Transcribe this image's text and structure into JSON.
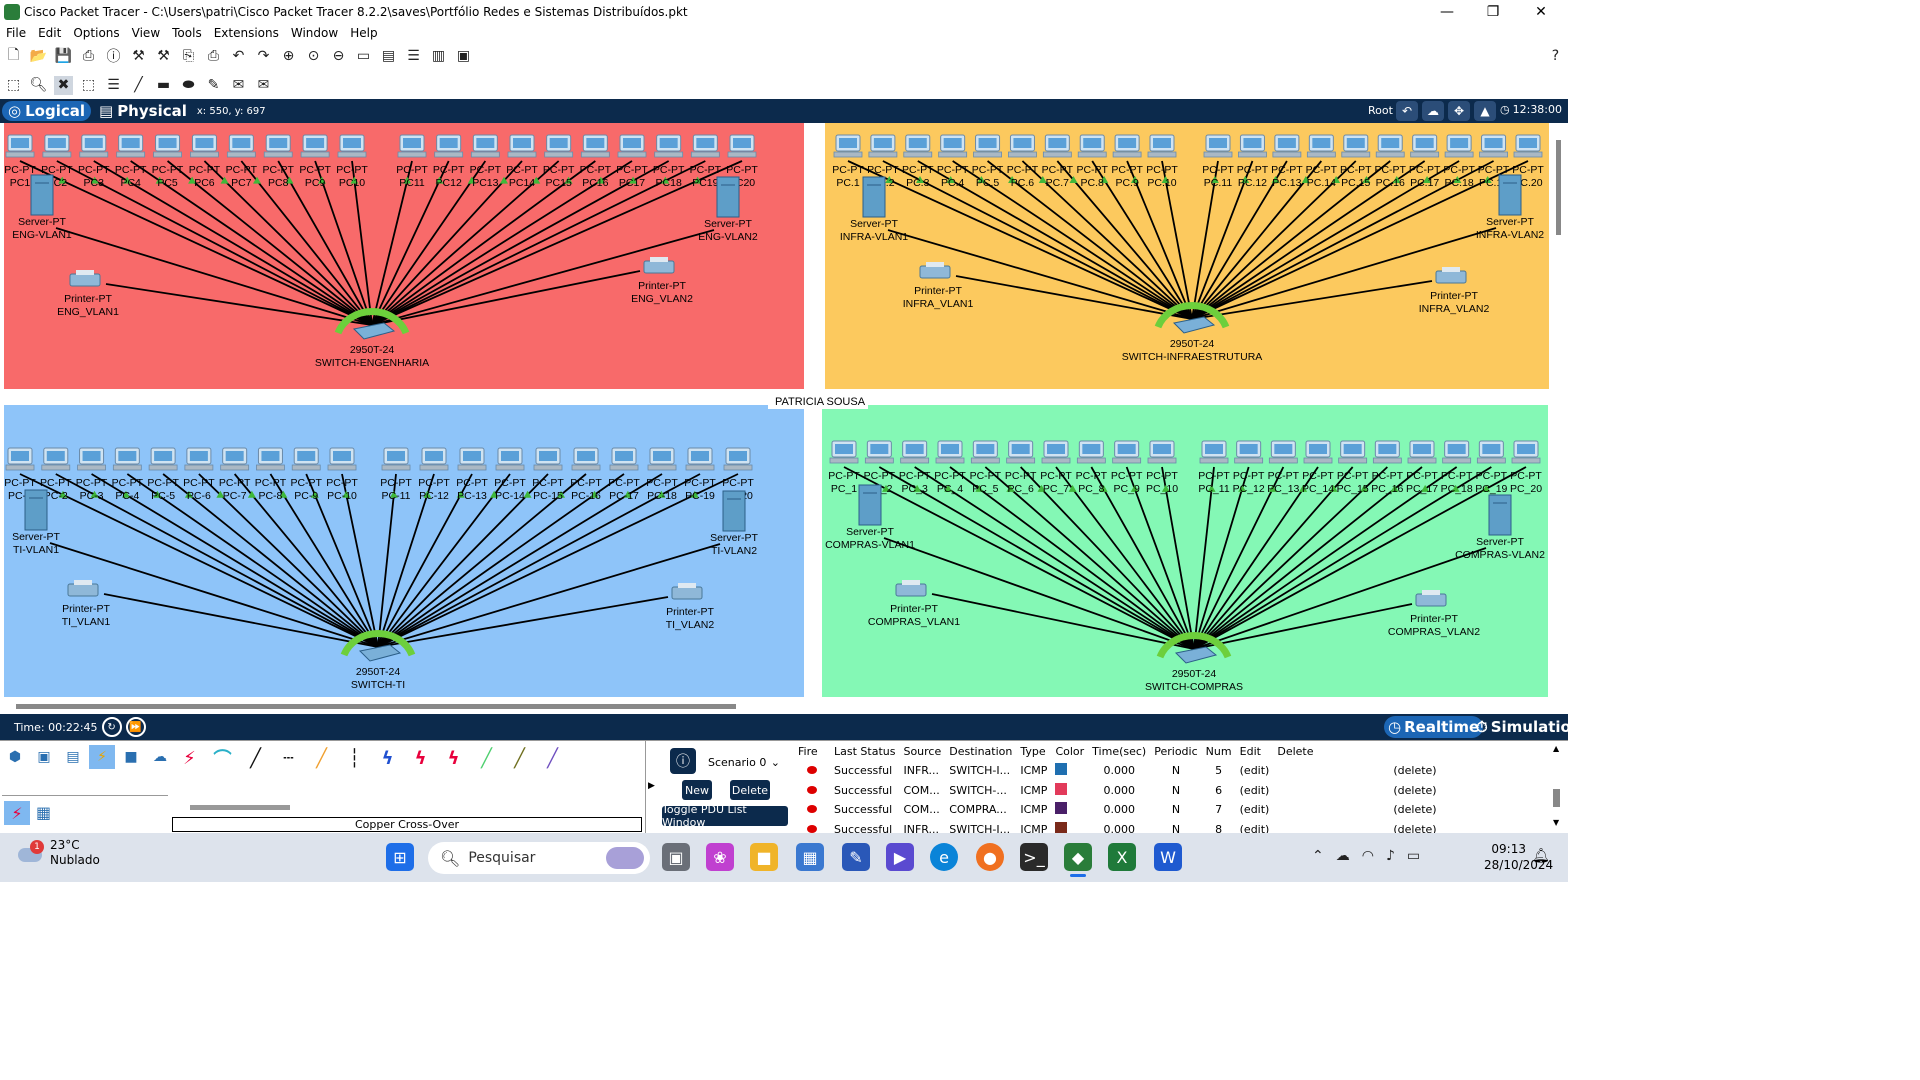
{
  "window": {
    "title": "Cisco Packet Tracer - C:\\Users\\patri\\Cisco Packet Tracer 8.2.2\\saves\\Portfólio Redes e Sistemas Distribuídos.pkt"
  },
  "menu": [
    "File",
    "Edit",
    "Options",
    "View",
    "Tools",
    "Extensions",
    "Window",
    "Help"
  ],
  "modes": {
    "logical": "Logical",
    "physical": "Physical",
    "coords": "x: 550, y: 697",
    "root": "Root",
    "clock": "12:38:00"
  },
  "canvas": {
    "label": "PATRICIA  SOUSA",
    "zones": [
      {
        "id": "eng",
        "color": "#f86a6a",
        "pc_types": [
          "PC-PT",
          "PC-PT",
          "PC-PT",
          "PC-PT",
          "PC-PT",
          "PC-PT",
          "PC-PT",
          "PC-PT",
          "PC-PT",
          "PC-PT",
          "PC-PT",
          "PC-PT",
          "PC-PT",
          "PC-PT",
          "PC-PT",
          "PC-PT",
          "PC-PT",
          "PC-PT",
          "PC-PT",
          "PC-PT"
        ],
        "pcs": [
          "PC1",
          "PC2",
          "PC3",
          "PC4",
          "PC5",
          "PC6",
          "PC7",
          "PC8",
          "PC9",
          "PC10",
          "PC11",
          "PC12",
          "PC13",
          "PC14",
          "PC15",
          "PC16",
          "PC17",
          "PC18",
          "PC19",
          "PC20"
        ],
        "switch": {
          "type": "2950T-24",
          "name": "SWITCH-ENGENHARIA"
        },
        "server1": {
          "type": "Server-PT",
          "name": "ENG-VLAN1"
        },
        "server2": {
          "type": "Server-PT",
          "name": "ENG-VLAN2"
        },
        "printer1": {
          "type": "Printer-PT",
          "name": "ENG_VLAN1"
        },
        "printer2": {
          "type": "Printer-PT",
          "name": "ENG_VLAN2"
        }
      },
      {
        "id": "infra",
        "color": "#fcc95e",
        "pc_types": [
          "PC-PT",
          "PC-PT",
          "PC-PT",
          "PC-PT",
          "PC-PT",
          "PC-PT",
          "PC-PT",
          "PC-PT",
          "PC-PT",
          "PC-PT",
          "PC-PT",
          "PC-PT",
          "PC-PT",
          "PC-PT",
          "PC-PT",
          "PC-PT",
          "PC-PT",
          "PC-PT",
          "PC-PT",
          "PC-PT"
        ],
        "pcs": [
          "PC.1",
          "PC.2",
          "PC.3",
          "PC.4",
          "PC.5",
          "PC.6",
          "PC.7",
          "PC.8",
          "PC.9",
          "PC.10",
          "PC.11",
          "PC.12",
          "PC.13",
          "PC.14",
          "PC.15",
          "PC.16",
          "PC.17",
          "PC.18",
          "PC.19",
          "PC.20"
        ],
        "switch": {
          "type": "2950T-24",
          "name": "SWITCH-INFRAESTRUTURA"
        },
        "server1": {
          "type": "Server-PT",
          "name": "INFRA-VLAN1"
        },
        "server2": {
          "type": "Server-PT",
          "name": "INFRA-VLAN2"
        },
        "printer1": {
          "type": "Printer-PT",
          "name": "INFRA_VLAN1"
        },
        "printer2": {
          "type": "Printer-PT",
          "name": "INFRA_VLAN2"
        }
      },
      {
        "id": "ti",
        "color": "#8ec4f9",
        "pc_types": [
          "PC-PT",
          "PC-PT",
          "PC-PT",
          "PC-PT",
          "PC-PT",
          "PC-PT",
          "PC-PT",
          "PC-PT",
          "PC-PT",
          "PC-PT",
          "PC-PT",
          "PC-PT",
          "PC-PT",
          "PC-PT",
          "PC-PT",
          "PC-PT",
          "PC-PT",
          "PC-PT",
          "PC-PT",
          "PC-PT"
        ],
        "pcs": [
          "PC-1",
          "PC-2",
          "PC-3",
          "PC-4",
          "PC-5",
          "PC-6",
          "PC-7",
          "PC-8",
          "PC-9",
          "PC-10",
          "PC-11",
          "PC-12",
          "PC-13",
          "PC-14",
          "PC-15",
          "PC-16",
          "PC-17",
          "PC-18",
          "PC-19",
          "PC-20"
        ],
        "switch": {
          "type": "2950T-24",
          "name": "SWITCH-TI"
        },
        "server1": {
          "type": "Server-PT",
          "name": "TI-VLAN1"
        },
        "server2": {
          "type": "Server-PT",
          "name": "TI-VLAN2"
        },
        "printer1": {
          "type": "Printer-PT",
          "name": "TI_VLAN1"
        },
        "printer2": {
          "type": "Printer-PT",
          "name": "TI_VLAN2"
        }
      },
      {
        "id": "compras",
        "color": "#84f8b5",
        "pc_types": [
          "PC-PT",
          "PC-PT",
          "PC-PT",
          "PC-PT",
          "PC-PT",
          "PC-PT",
          "PC-PT",
          "PC-PT",
          "PC-PT",
          "PC-PT",
          "PC-PT",
          "PC-PT",
          "PC-PT",
          "PC-PT",
          "PC-PT",
          "PC-PT",
          "PC-PT",
          "PC-PT",
          "PC-PT",
          "PC-PT"
        ],
        "pcs": [
          "PC_1",
          "PC_2",
          "PC_3",
          "PC_4",
          "PC_5",
          "PC_6",
          "PC_7",
          "PC_8",
          "PC_9",
          "PC_10",
          "PC_11",
          "PC_12",
          "PC_13",
          "PC_14",
          "PC_15",
          "PC_16",
          "PC_17",
          "PC_18",
          "PC_19",
          "PC_20"
        ],
        "switch": {
          "type": "2950T-24",
          "name": "SWITCH-COMPRAS"
        },
        "server1": {
          "type": "Server-PT",
          "name": "COMPRAS-VLAN1"
        },
        "server2": {
          "type": "Server-PT",
          "name": "COMPRAS-VLAN2"
        },
        "printer1": {
          "type": "Printer-PT",
          "name": "COMPRAS_VLAN1"
        },
        "printer2": {
          "type": "Printer-PT",
          "name": "COMPRAS_VLAN2"
        }
      }
    ]
  },
  "status": {
    "time": "Time: 00:22:45",
    "realtime": "Realtime",
    "simulation": "Simulation"
  },
  "connections": {
    "selected_label": "Copper Cross-Over"
  },
  "pdu": {
    "scenario": "Scenario 0",
    "new": "New",
    "delete": "Delete",
    "toggle": "Toggle PDU List Window",
    "headers": [
      "Fire",
      "Last Status",
      "Source",
      "Destination",
      "Type",
      "Color",
      "Time(sec)",
      "Periodic",
      "Num",
      "Edit",
      "Delete"
    ],
    "rows": [
      {
        "status": "Successful",
        "source": "INFR...",
        "dest": "SWITCH-I...",
        "type": "ICMP",
        "color": "#1f6fb0",
        "time": "0.000",
        "periodic": "N",
        "num": "5",
        "edit": "(edit)",
        "delete": "(delete)"
      },
      {
        "status": "Successful",
        "source": "COM...",
        "dest": "SWITCH-...",
        "type": "ICMP",
        "color": "#e23a5a",
        "time": "0.000",
        "periodic": "N",
        "num": "6",
        "edit": "(edit)",
        "delete": "(delete)"
      },
      {
        "status": "Successful",
        "source": "COM...",
        "dest": "COMPRA...",
        "type": "ICMP",
        "color": "#4a2068",
        "time": "0.000",
        "periodic": "N",
        "num": "7",
        "edit": "(edit)",
        "delete": "(delete)"
      },
      {
        "status": "Successful",
        "source": "INFR...",
        "dest": "SWITCH-I...",
        "type": "ICMP",
        "color": "#7a2a1a",
        "time": "0.000",
        "periodic": "N",
        "num": "8",
        "edit": "(edit)",
        "delete": "(delete)"
      }
    ]
  },
  "taskbar": {
    "temp": "23°C",
    "weather": "Nublado",
    "badge": "1",
    "search": "Pesquisar",
    "time": "09:13",
    "date": "28/10/2024"
  }
}
